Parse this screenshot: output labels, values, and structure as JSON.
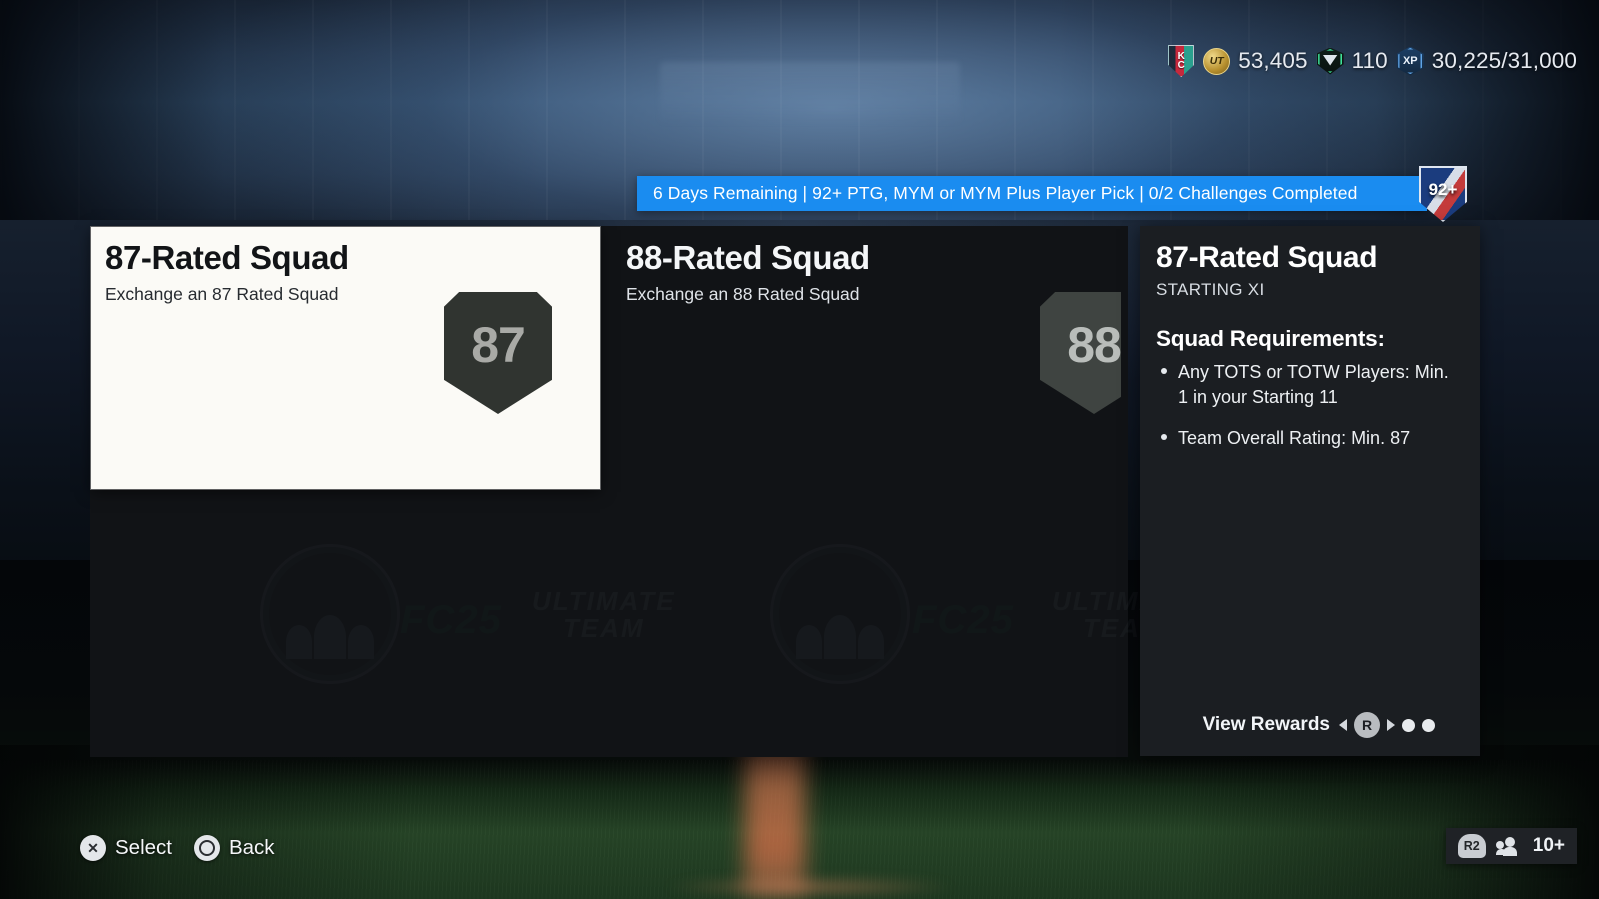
{
  "hud": {
    "club_crest": {
      "icon": "club-crest-icon",
      "line1": "K",
      "line2": "C"
    },
    "coins": {
      "icon": "ut-coins-icon",
      "icon_text": "UT",
      "value": "53,405"
    },
    "fc_points": {
      "icon": "fc-points-icon",
      "value": "110"
    },
    "xp": {
      "icon": "xp-icon",
      "icon_text": "XP",
      "value": "30,225/31,000"
    }
  },
  "banner": {
    "text": "6 Days Remaining | 92+ PTG, MYM or MYM Plus Player Pick | 0/2 Challenges Completed",
    "badge_text": "92+",
    "badge_icon": "player-pick-shield-icon",
    "accent_color": "#1a8cf0"
  },
  "challenges": [
    {
      "title": "87-Rated Squad",
      "subtitle": "Exchange an 87 Rated Squad",
      "rating": "87",
      "selected": true
    },
    {
      "title": "88-Rated Squad",
      "subtitle": "Exchange an 88 Rated Squad",
      "rating": "88",
      "selected": false
    }
  ],
  "detail": {
    "title": "87-Rated Squad",
    "subtitle": "STARTING XI",
    "requirements_heading": "Squad Requirements:",
    "requirements": [
      "Any TOTS or TOTW Players: Min. 1 in your Starting 11",
      "Team Overall Rating: Min. 87"
    ],
    "rewards_label": "View Rewards",
    "rewards_button": "R",
    "page_dots": 2
  },
  "watermarks": {
    "ultimate_team": "ULTIMATE\nTEAM",
    "fc25": "FC25"
  },
  "bottom_bar": {
    "actions": [
      {
        "button": "✕",
        "label": "Select",
        "icon": "cross-button-icon"
      },
      {
        "button": "○",
        "label": "Back",
        "icon": "circle-button-icon"
      }
    ],
    "online": {
      "button": "R2",
      "icon": "people-icon",
      "count": "10+"
    }
  }
}
